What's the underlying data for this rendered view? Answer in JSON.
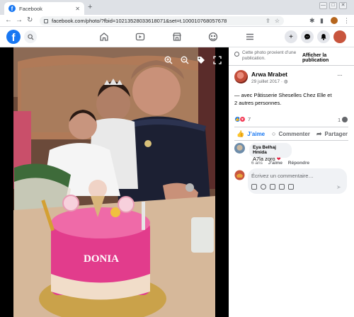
{
  "browser": {
    "tab_title": "Facebook",
    "tab_close": "✕",
    "new_tab": "+",
    "url": "facebook.com/photo/?fbid=10213528033618071&set=t.100010768057678",
    "window_controls": [
      "—",
      "□",
      "✕"
    ]
  },
  "facebook": {
    "logo": "f",
    "nav_icons": [
      "home-icon",
      "watch-icon",
      "marketplace-icon",
      "groups-icon",
      "menu-icon"
    ],
    "right_buttons": [
      "create-icon",
      "messenger-icon",
      "notifications-icon",
      "account-avatar"
    ],
    "brand_color": "#1877f2"
  },
  "photo": {
    "cake_name": "DONIA",
    "controls": [
      "zoom-in-icon",
      "zoom-out-icon",
      "tag-icon",
      "fullscreen-icon"
    ]
  },
  "panel": {
    "notice": "Cette photo provient d’une publication.",
    "show_post": "Afficher la publication",
    "author": "Arwa Mrabet",
    "date": "29 juillet 2017 · ",
    "more": "···",
    "with_line1": "— avec Pâtisserie Sheselles Chez Elle et",
    "with_line2": "2 autres personnes.",
    "reaction_count": "7",
    "comment_count": "1",
    "actions": {
      "like": "J’aime",
      "comment": "Commenter",
      "share": "Partager"
    },
    "comment": {
      "name": "Eya Belhaj Hmida",
      "text": "A7la zoro",
      "age": "6 ans",
      "like": "J’aime",
      "reply": "Répondre"
    },
    "write_placeholder": "Écrivez un commentaire…"
  }
}
